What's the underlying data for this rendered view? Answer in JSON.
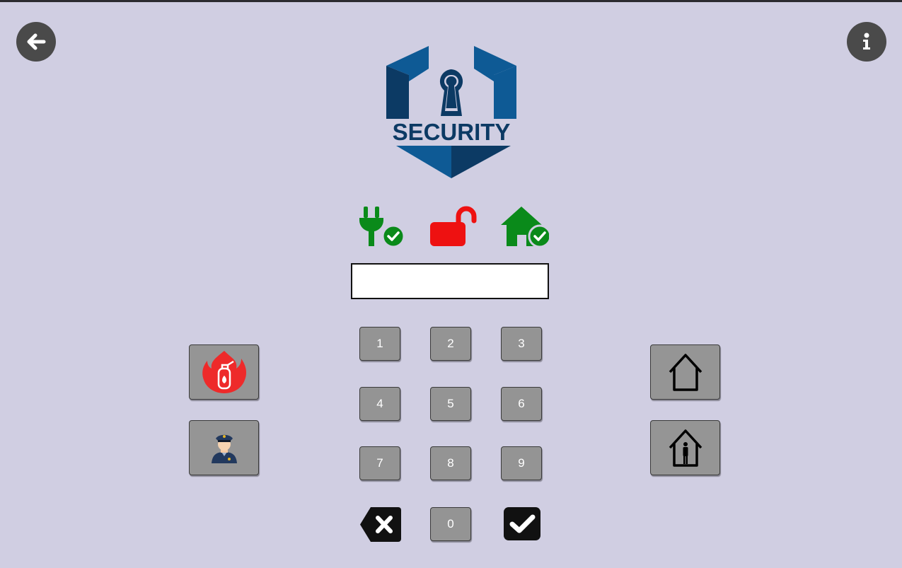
{
  "logo": {
    "text": "SECURITY"
  },
  "display": {
    "value": ""
  },
  "keypad": {
    "keys": [
      "1",
      "2",
      "3",
      "4",
      "5",
      "6",
      "7",
      "8",
      "9",
      "0"
    ]
  },
  "icons": {
    "back": "arrow-left-circle-icon",
    "info": "info-circle-icon",
    "power": "plug-check-icon",
    "lock": "unlocked-padlock-icon",
    "home": "home-check-icon",
    "fire": "fire-extinguisher-icon",
    "police": "police-officer-icon",
    "away": "house-outline-icon",
    "stay": "house-person-icon",
    "clear": "backspace-x-icon",
    "enter": "checkmark-icon"
  },
  "colors": {
    "background": "#d0cee2",
    "ok_green": "#0a8a1a",
    "alert_red": "#ee1111",
    "key_gray": "#949494",
    "logo_dark": "#0c3a64",
    "logo_mid": "#0e5a95"
  }
}
